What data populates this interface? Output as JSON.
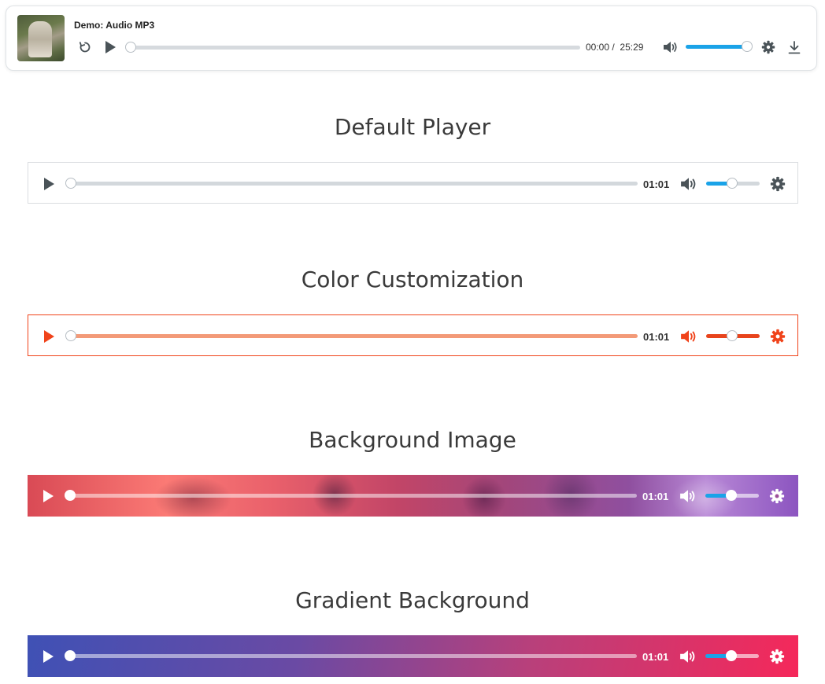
{
  "demo": {
    "title": "Demo: Audio MP3",
    "current_time": "00:00",
    "separator": "/",
    "duration": "25:29",
    "progress": 0,
    "volume": 1.0,
    "thumbnail_icon": "album-art",
    "accent_color": "#1aa3e8"
  },
  "sections": [
    {
      "heading": "Default Player",
      "time": "01:01",
      "progress": 0,
      "volume": 0.5,
      "accent_color": "#1aa3e8",
      "control_color": "#4a5358"
    },
    {
      "heading": "Color Customization",
      "time": "01:01",
      "progress": 0,
      "volume": 0.5,
      "accent_color": "#f0431a",
      "control_color": "#f0431a"
    },
    {
      "heading": "Background Image",
      "time": "01:01",
      "progress": 0,
      "volume": 0.5,
      "accent_color": "#1aa3e8",
      "control_color": "#ffffff"
    },
    {
      "heading": "Gradient Background",
      "time": "01:01",
      "progress": 0,
      "volume": 0.5,
      "accent_color": "#1aa3e8",
      "control_color": "#ffffff"
    }
  ],
  "icons": {
    "restart": "restart-icon",
    "play": "play-icon",
    "volume": "volume-icon",
    "settings": "gear-icon",
    "download": "download-icon"
  }
}
